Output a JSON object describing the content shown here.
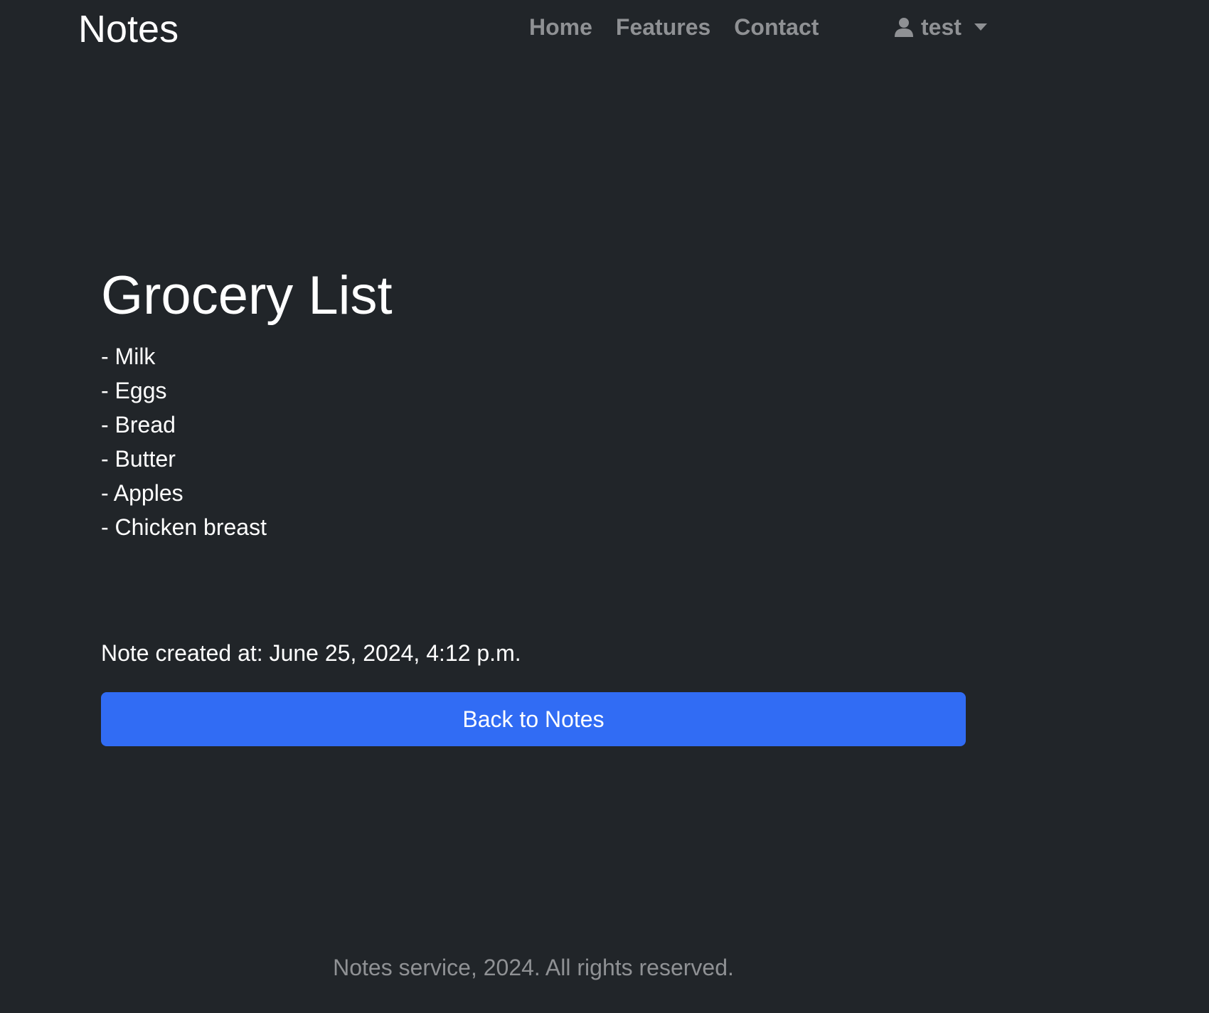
{
  "navbar": {
    "brand": "Notes",
    "links": [
      {
        "label": "Home"
      },
      {
        "label": "Features"
      },
      {
        "label": "Contact"
      }
    ],
    "user": {
      "icon": "user-icon",
      "name": "test",
      "caret_icon": "caret-down-icon"
    }
  },
  "note": {
    "title": "Grocery List",
    "lines": [
      "- Milk",
      "- Eggs",
      "- Bread",
      "- Butter",
      "- Apples",
      "- Chicken breast"
    ],
    "created_at": "Note created at: June 25, 2024, 4:12 p.m."
  },
  "actions": {
    "back_label": "Back to Notes"
  },
  "footer": {
    "text": "Notes service, 2024. All rights reserved."
  },
  "colors": {
    "background": "#212529",
    "primary_button": "#316cf4",
    "muted_text": "#8f9194"
  }
}
